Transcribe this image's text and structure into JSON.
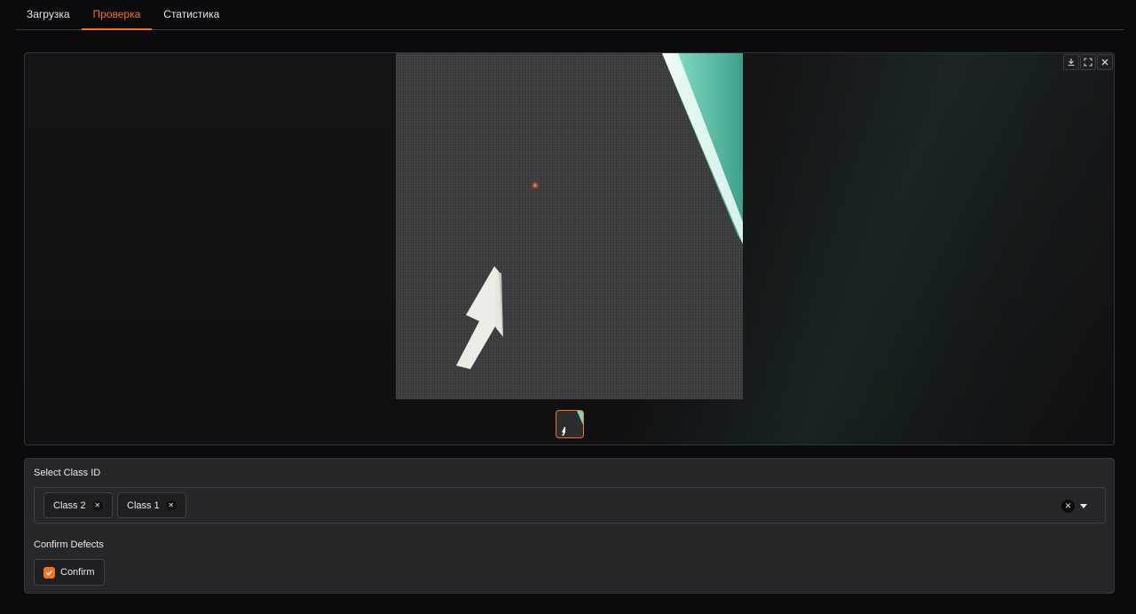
{
  "tabs": [
    {
      "label": "Загрузка",
      "active": false
    },
    {
      "label": "Проверка",
      "active": true
    },
    {
      "label": "Статистика",
      "active": false
    }
  ],
  "gallery": {
    "toolbar_icons": [
      "download-icon",
      "fullscreen-icon",
      "close-icon"
    ],
    "thumbnail_count": 1,
    "selected_thumbnail": 1
  },
  "class_select": {
    "label": "Select Class ID",
    "chips": [
      "Class 2",
      "Class 1"
    ]
  },
  "confirm_defects": {
    "label": "Confirm Defects",
    "checkbox_label": "Confirm",
    "checked": true
  },
  "colors": {
    "accent": "#f97316",
    "background": "#0b0b0d",
    "panel": "#27272a"
  }
}
